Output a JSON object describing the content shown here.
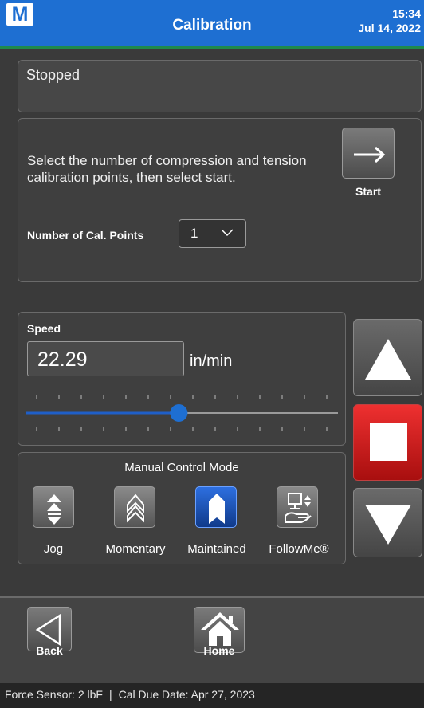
{
  "header": {
    "logo_letter": "M",
    "title": "Calibration",
    "time": "15:34",
    "date": "Jul 14, 2022",
    "colors": {
      "bar": "#1e6fd2",
      "stripe": "#1f8a4c"
    }
  },
  "status": {
    "text": "Stopped"
  },
  "instructions": {
    "text": "Select the number of compression and tension calibration points, then select start.",
    "cal_points_label": "Number of Cal. Points",
    "cal_points_value": "1",
    "start_label": "Start"
  },
  "speed": {
    "label": "Speed",
    "value": "22.29",
    "unit": "in/min",
    "slider_fraction": 0.49
  },
  "manual_control": {
    "title": "Manual Control Mode",
    "modes": [
      {
        "label": "Jog",
        "icon": "jog-triangles-icon",
        "active": false
      },
      {
        "label": "Momentary",
        "icon": "momentary-chevrons-icon",
        "active": false
      },
      {
        "label": "Maintained",
        "icon": "maintained-icon",
        "active": true
      },
      {
        "label": "FollowMe®",
        "icon": "followme-hand-icon",
        "active": false
      }
    ]
  },
  "motion_controls": {
    "up_icon": "up-arrow-icon",
    "stop_icon": "stop-square-icon",
    "down_icon": "down-arrow-icon",
    "colors": {
      "stop": "#e02020"
    }
  },
  "bottom_nav": {
    "back_label": "Back",
    "home_label": "Home"
  },
  "footer": {
    "sensor": "Force Sensor: 2 lbF",
    "separator": "|",
    "cal_due": "Cal Due Date: Apr 27, 2023"
  }
}
